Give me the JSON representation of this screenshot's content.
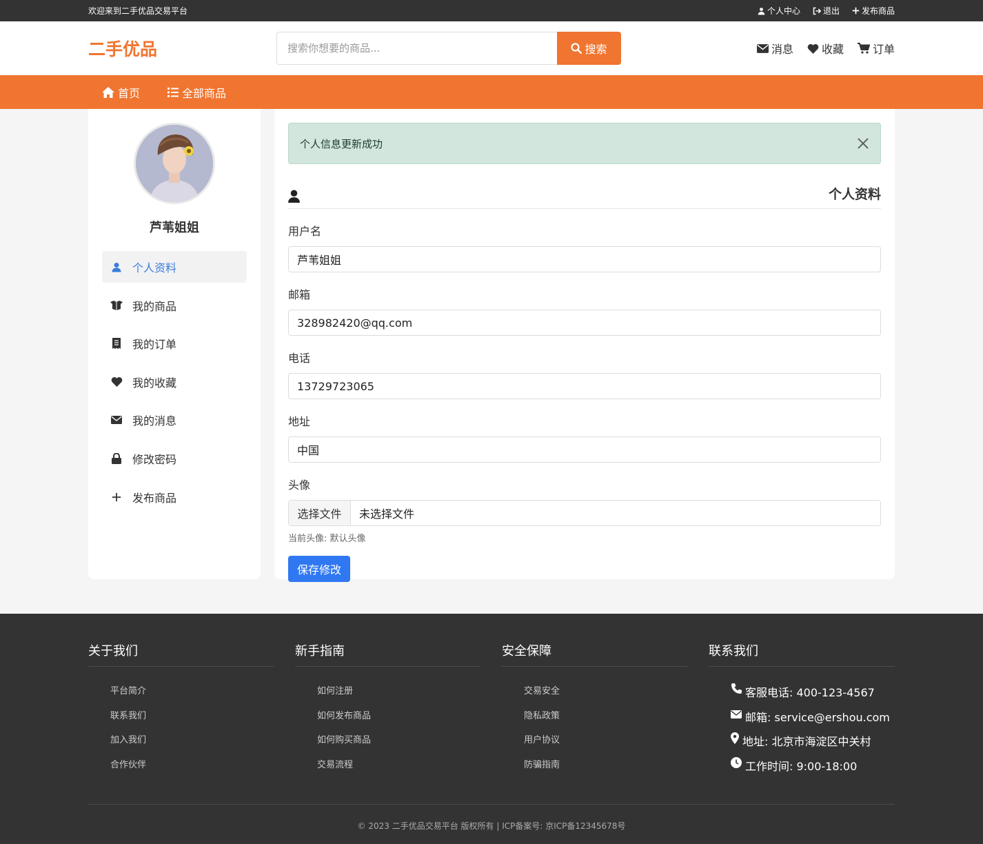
{
  "topbar": {
    "welcome": "欢迎来到二手优品交易平台",
    "links": [
      "个人中心",
      "退出",
      "发布商品"
    ]
  },
  "header": {
    "logo": "二手优品",
    "search_placeholder": "搜索你想要的商品...",
    "search_button": "搜索",
    "links": [
      "消息",
      "收藏",
      "订单"
    ]
  },
  "nav": {
    "items": [
      "首页",
      "全部商品"
    ]
  },
  "sidebar": {
    "username": "芦苇姐姐",
    "menu": [
      {
        "label": "个人资料",
        "icon": "user-icon"
      },
      {
        "label": "我的商品",
        "icon": "box-icon"
      },
      {
        "label": "我的订单",
        "icon": "receipt-icon"
      },
      {
        "label": "我的收藏",
        "icon": "heart-icon"
      },
      {
        "label": "我的消息",
        "icon": "envelope-icon"
      },
      {
        "label": "修改密码",
        "icon": "lock-icon"
      },
      {
        "label": "发布商品",
        "icon": "plus-icon"
      }
    ]
  },
  "alert": {
    "message": "个人信息更新成功"
  },
  "profile": {
    "title": "个人资料",
    "fields": [
      {
        "label": "用户名",
        "value": "芦苇姐姐"
      },
      {
        "label": "邮箱",
        "value": "328982420@qq.com"
      },
      {
        "label": "电话",
        "value": "13729723065"
      },
      {
        "label": "地址",
        "value": "中国"
      }
    ],
    "avatar_label": "头像",
    "file_button": "选择文件",
    "file_status": "未选择文件",
    "avatar_hint": "当前头像: 默认头像",
    "save_button": "保存修改"
  },
  "footer": {
    "columns": [
      {
        "title": "关于我们",
        "items": [
          "平台简介",
          "联系我们",
          "加入我们",
          "合作伙伴"
        ]
      },
      {
        "title": "新手指南",
        "items": [
          "如何注册",
          "如何发布商品",
          "如何购买商品",
          "交易流程"
        ]
      },
      {
        "title": "安全保障",
        "items": [
          "交易安全",
          "隐私政策",
          "用户协议",
          "防骗指南"
        ]
      }
    ],
    "contact": {
      "title": "联系我们",
      "items": [
        "客服电话: 400-123-4567",
        "邮箱: service@ershou.com",
        "地址: 北京市海淀区中关村",
        "工作时间: 9:00-18:00"
      ]
    },
    "copyright": "© 2023 二手优品交易平台 版权所有 | ICP备案号: 京ICP备12345678号"
  },
  "colors": {
    "brand": "#f07530",
    "primary": "#2f78f2",
    "success_bg": "#d2e6dd",
    "dark": "#333333"
  }
}
